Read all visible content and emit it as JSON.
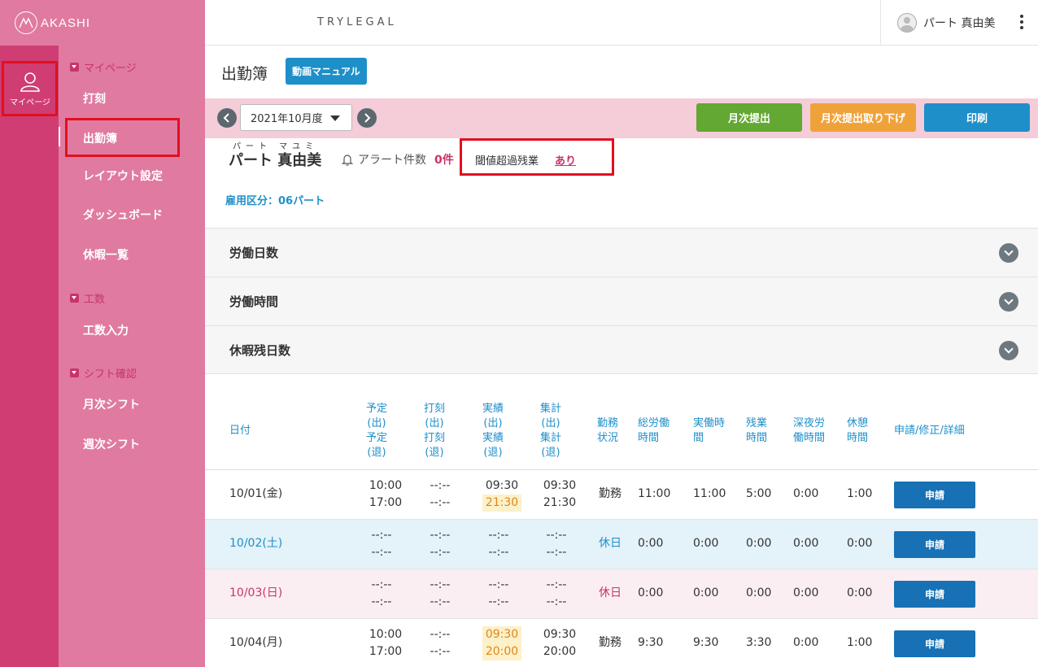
{
  "app": {
    "logo_text": "AKASHI",
    "brand": "TRYLEGAL"
  },
  "rail": {
    "mypage_label": "マイページ"
  },
  "sidebar": {
    "sections": [
      {
        "label": "マイページ",
        "items": [
          "打刻",
          "出勤簿",
          "レイアウト設定",
          "ダッシュボード",
          "休暇一覧"
        ]
      },
      {
        "label": "工数",
        "items": [
          "工数入力"
        ]
      },
      {
        "label": "シフト確認",
        "items": [
          "月次シフト",
          "週次シフト"
        ]
      }
    ]
  },
  "header": {
    "user_name": "パート 真由美"
  },
  "page": {
    "title": "出勤簿",
    "manual_button": "動画マニュアル"
  },
  "toolbar": {
    "period": "2021年10月度",
    "monthly_submit": "月次提出",
    "monthly_withdraw": "月次提出取り下げ",
    "print": "印刷",
    "colors": {
      "submit": "#62a832",
      "withdraw": "#f0a23a",
      "print": "#1e8fc9"
    }
  },
  "employee": {
    "furigana": "パート マユミ",
    "name": "パート 真由美",
    "alert_label": "アラート件数",
    "alert_count": "0件",
    "threshold_label": "閾値超過残業",
    "threshold_value": "あり",
    "employment_type": "雇用区分：06パート"
  },
  "panels": [
    "労働日数",
    "労働時間",
    "休暇残日数"
  ],
  "table": {
    "headers": {
      "date": "日付",
      "scheduled": [
        "予定",
        "(出)",
        "予定",
        "(退)"
      ],
      "stamped": [
        "打刻",
        "(出)",
        "打刻",
        "(退)"
      ],
      "actual": [
        "実績",
        "(出)",
        "実績",
        "(退)"
      ],
      "totaled": [
        "集計",
        "(出)",
        "集計",
        "(退)"
      ],
      "status": [
        "勤務",
        "状況"
      ],
      "total_work": [
        "総労働",
        "時間"
      ],
      "real_work": [
        "実働時",
        "間"
      ],
      "overtime": [
        "残業",
        "時間"
      ],
      "late_night": [
        "深夜労",
        "働時間"
      ],
      "break": [
        "休憩",
        "時間"
      ],
      "actions": "申請/修正/詳細"
    },
    "rows": [
      {
        "date": "10/01(金)",
        "sched_in": "10:00",
        "sched_out": "17:00",
        "stamp_in": "--:--",
        "stamp_out": "--:--",
        "actual_in": "09:30",
        "actual_out": "21:30",
        "agg_in": "09:30",
        "agg_out": "21:30",
        "status": "勤務",
        "total": "11:00",
        "real": "11:00",
        "overtime": "5:00",
        "late_night": "0:00",
        "break": "1:00",
        "action": "申請"
      },
      {
        "date": "10/02(土)",
        "sched_in": "--:--",
        "sched_out": "--:--",
        "stamp_in": "--:--",
        "stamp_out": "--:--",
        "actual_in": "--:--",
        "actual_out": "--:--",
        "agg_in": "--:--",
        "agg_out": "--:--",
        "status": "休日",
        "total": "0:00",
        "real": "0:00",
        "overtime": "0:00",
        "late_night": "0:00",
        "break": "0:00",
        "action": "申請"
      },
      {
        "date": "10/03(日)",
        "sched_in": "--:--",
        "sched_out": "--:--",
        "stamp_in": "--:--",
        "stamp_out": "--:--",
        "actual_in": "--:--",
        "actual_out": "--:--",
        "agg_in": "--:--",
        "agg_out": "--:--",
        "status": "休日",
        "total": "0:00",
        "real": "0:00",
        "overtime": "0:00",
        "late_night": "0:00",
        "break": "0:00",
        "action": "申請"
      },
      {
        "date": "10/04(月)",
        "sched_in": "10:00",
        "sched_out": "17:00",
        "stamp_in": "--:--",
        "stamp_out": "--:--",
        "actual_in": "09:30",
        "actual_out": "20:00",
        "agg_in": "09:30",
        "agg_out": "20:00",
        "status": "勤務",
        "total": "9:30",
        "real": "9:30",
        "overtime": "3:30",
        "late_night": "0:00",
        "break": "1:00",
        "action": "申請"
      }
    ],
    "colors": {
      "saturday": "#1e8fc9",
      "sunday": "#c8336a",
      "highlight_text": "#e0861d",
      "highlight_bg": "#fcf1c9"
    }
  }
}
